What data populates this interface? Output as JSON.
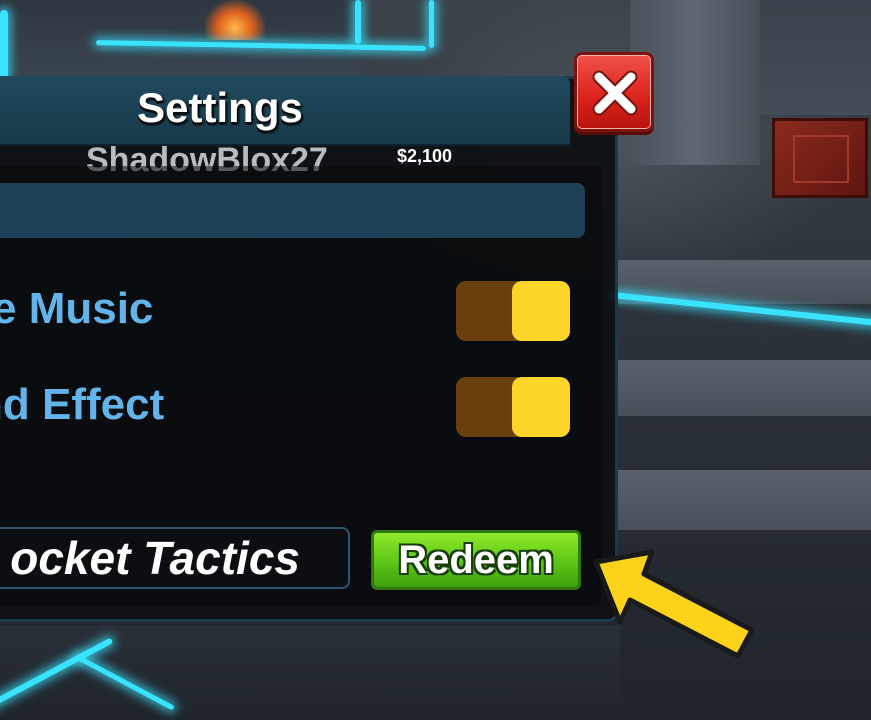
{
  "panel": {
    "title": "Settings",
    "player_name": "ShadowBlox27",
    "cash": "$2,100",
    "close_icon": "close-x-icon"
  },
  "settings": [
    {
      "label": "e Music",
      "enabled": true
    },
    {
      "label": "nd Effect",
      "enabled": true
    }
  ],
  "redeem": {
    "code_value": "ocket Tactics",
    "button_label": "Redeem"
  },
  "colors": {
    "header": "#17394a",
    "label": "#62b4ea",
    "toggle_track": "#6a3f0e",
    "toggle_knob": "#fdd52a",
    "redeem_button": "#5cc514",
    "close_button": "#d9211a",
    "arrow": "#fdd21a"
  },
  "annotation_icon": "yellow-arrow-icon"
}
